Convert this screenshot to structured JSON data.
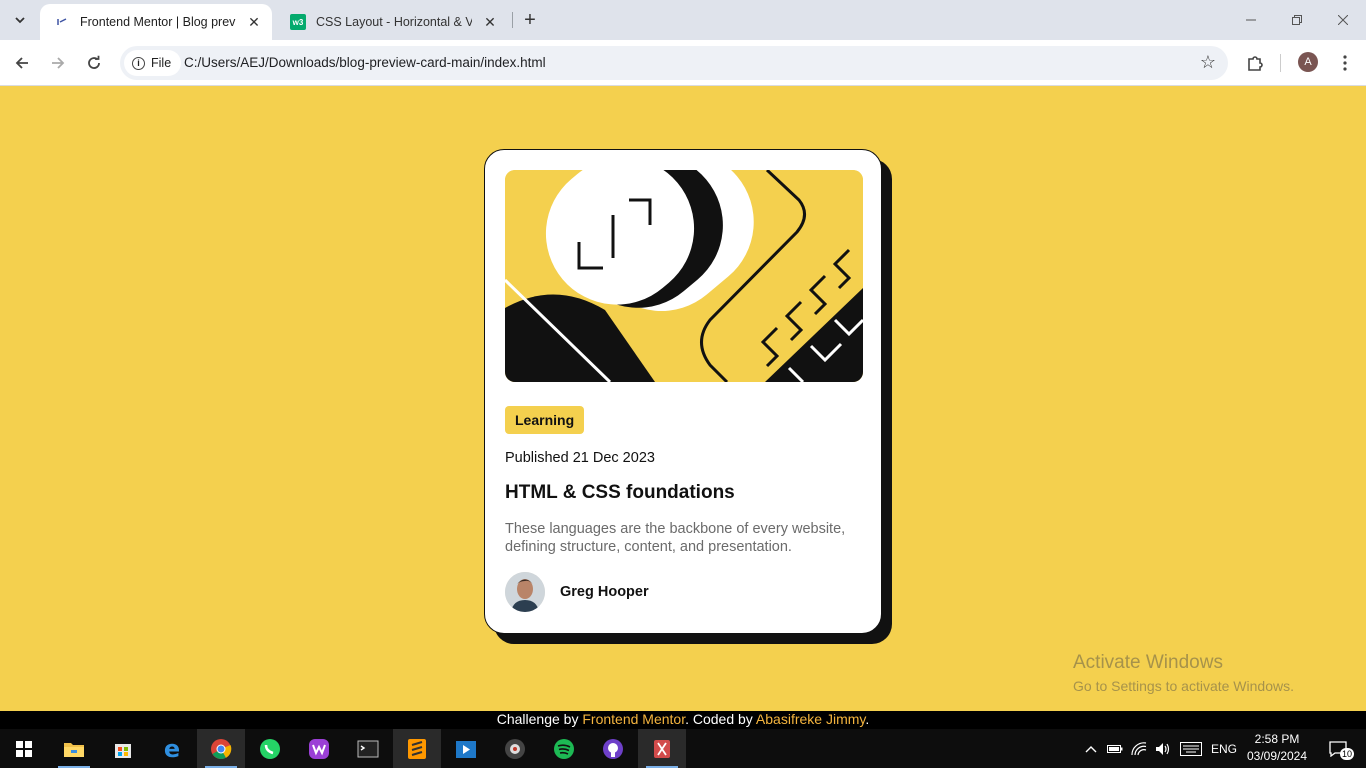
{
  "browser": {
    "tabs": [
      {
        "title": "Frontend Mentor | Blog preview card",
        "active": true
      },
      {
        "title": "CSS Layout - Horizontal & Vertical Align",
        "active": false
      }
    ],
    "address": {
      "chip_label": "File",
      "url": "C:/Users/AEJ/Downloads/blog-preview-card-main/index.html"
    },
    "profile_initial": "A"
  },
  "card": {
    "tag": "Learning",
    "published": "Published 21 Dec 2023",
    "title": "HTML & CSS foundations",
    "description": "These languages are the backbone of every website, defining structure, content, and presentation.",
    "author": "Greg Hooper"
  },
  "watermark": {
    "line1": "Activate Windows",
    "line2": "Go to Settings to activate Windows."
  },
  "attribution": {
    "prefix": "Challenge by ",
    "link1": "Frontend Mentor",
    "middle": ". Coded by ",
    "link2": "Abasifreke Jimmy",
    "suffix": "."
  },
  "taskbar": {
    "language": "ENG",
    "time": "2:58 PM",
    "date": "03/09/2024",
    "notification_count": "10"
  },
  "colors": {
    "background": "#f4d04e",
    "text": "#111111",
    "muted": "#6b6b6b",
    "link": "#f4b43e"
  }
}
